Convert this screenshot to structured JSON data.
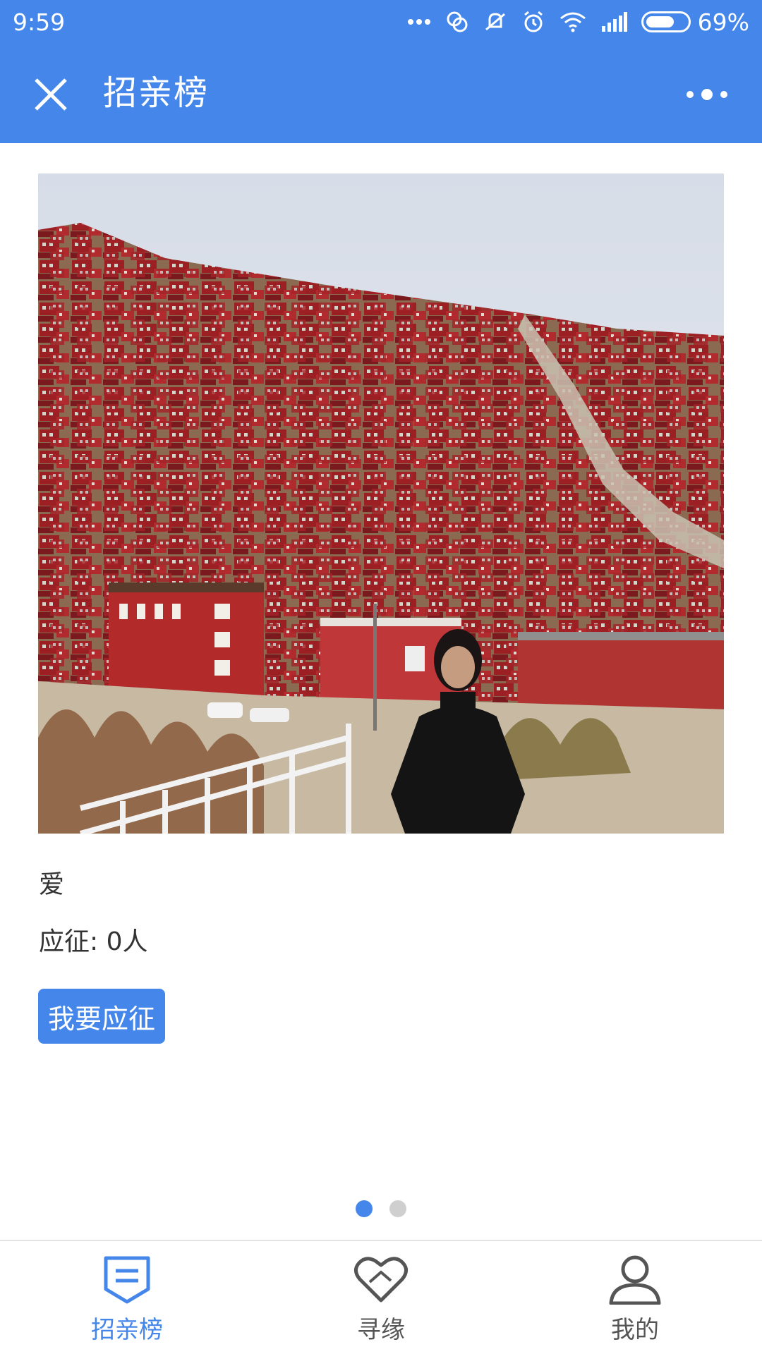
{
  "status_bar": {
    "time": "9:59",
    "battery_percent": "69%",
    "battery_level": 0.69
  },
  "header": {
    "title": "招亲榜"
  },
  "profile": {
    "name": "爱",
    "applicants_label": "应征: 0人",
    "apply_button": "我要应征"
  },
  "pager": {
    "count": 2,
    "active_index": 0
  },
  "bottom_nav": {
    "items": [
      {
        "label": "招亲榜",
        "icon": "list-shield-icon",
        "active": true
      },
      {
        "label": "寻缘",
        "icon": "heart-icon",
        "active": false
      },
      {
        "label": "我的",
        "icon": "user-icon",
        "active": false
      }
    ]
  },
  "colors": {
    "primary": "#4486ea",
    "inactive": "#555555"
  }
}
